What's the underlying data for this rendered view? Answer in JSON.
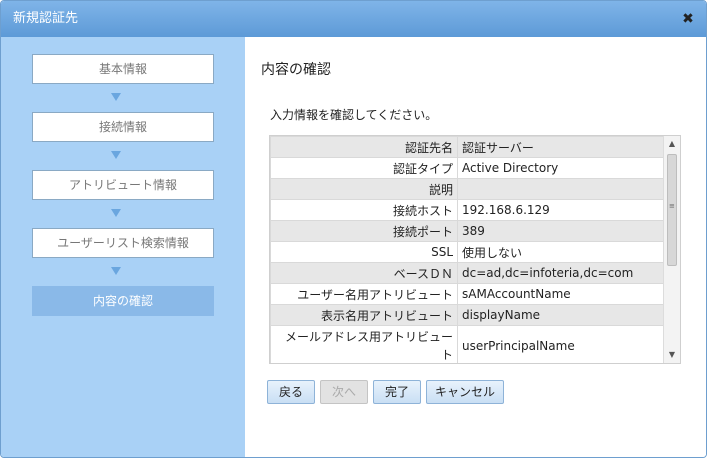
{
  "dialog": {
    "title": "新規認証先",
    "close_glyph": "✖"
  },
  "sidebar": {
    "steps": [
      {
        "label": "基本情報"
      },
      {
        "label": "接続情報"
      },
      {
        "label": "アトリビュート情報"
      },
      {
        "label": "ユーザーリスト検索情報"
      },
      {
        "label": "内容の確認"
      }
    ],
    "active_index": 4
  },
  "content": {
    "heading": "内容の確認",
    "instruction": "入力情報を確認してください。",
    "rows": [
      {
        "label": "認証先名",
        "value": "認証サーバー"
      },
      {
        "label": "認証タイプ",
        "value": "Active Directory"
      },
      {
        "label": "説明",
        "value": ""
      },
      {
        "label": "接続ホスト",
        "value": "192.168.6.129"
      },
      {
        "label": "接続ポート",
        "value": "389"
      },
      {
        "label": "SSL",
        "value": "使用しない"
      },
      {
        "label": "ベースＤＮ",
        "value": "dc=ad,dc=infoteria,dc=com"
      },
      {
        "label": "ユーザー名用アトリビュート",
        "value": "sAMAccountName"
      },
      {
        "label": "表示名用アトリビュート",
        "value": "displayName"
      },
      {
        "label": "メールアドレス用アトリビュート",
        "value": "userPrincipalName"
      }
    ]
  },
  "buttons": {
    "back": "戻る",
    "next": "次へ",
    "finish": "完了",
    "cancel": "キャンセル"
  },
  "colors": {
    "titlebar": "#6aa6df",
    "sidebar": "#a9d1f6",
    "active_step": "#8ab9e8",
    "row_shade": "#e7e7e7"
  }
}
